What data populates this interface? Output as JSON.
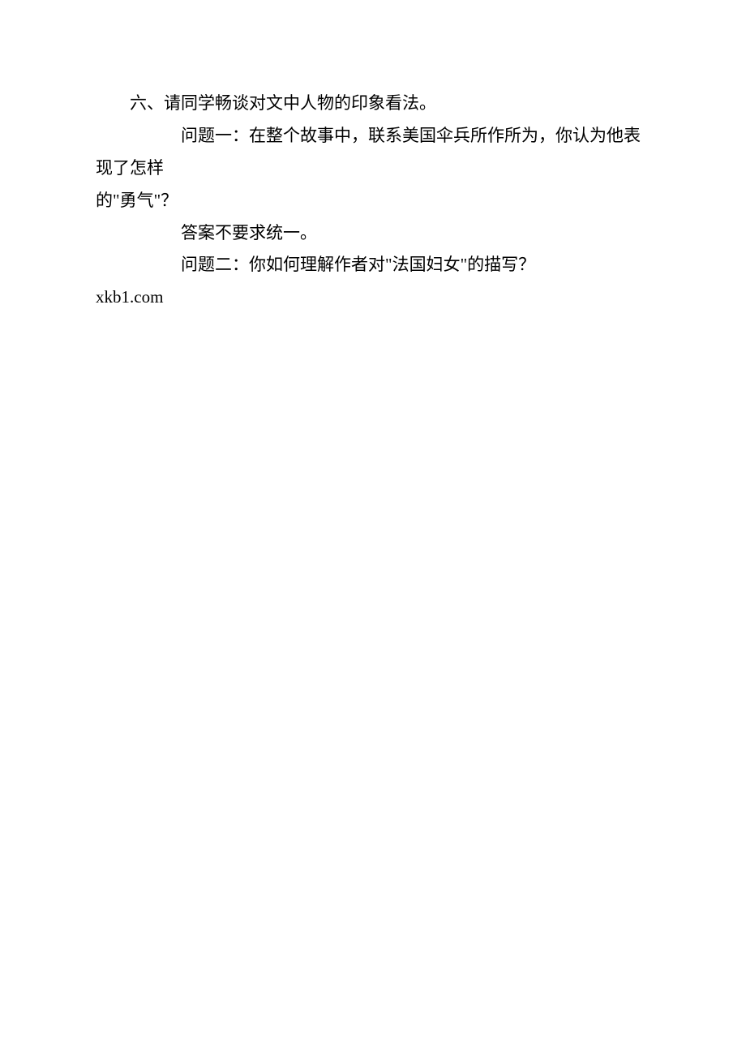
{
  "lines": {
    "heading": "六、请同学畅谈对文中人物的印象看法。",
    "q1a": "问题一：在整个故事中，联系美国伞兵所作所为，你认为他表现了怎样",
    "q1b": "的\"勇气\"？",
    "answer": "答案不要求统一。",
    "q2": "问题二：你如何理解作者对\"法国妇女\"的描写？",
    "footer": "xkb1.com"
  }
}
